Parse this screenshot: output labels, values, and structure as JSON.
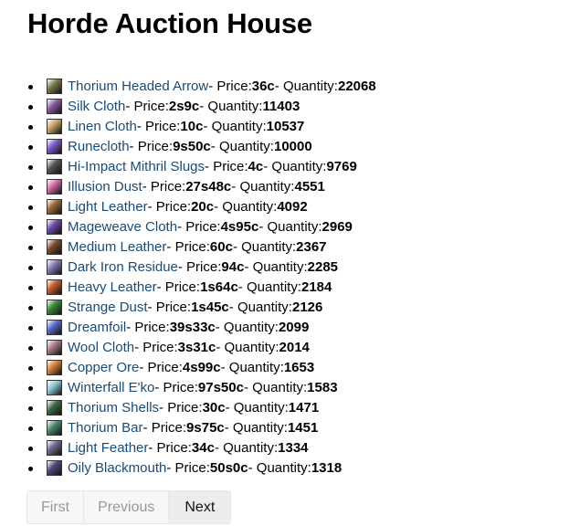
{
  "page_title": "Horde Auction House",
  "items": [
    {
      "name": "Thorium Headed Arrow",
      "price": "36c",
      "quantity": "22068",
      "icon": "arrow-icon",
      "icon_color": "#7a7a4a"
    },
    {
      "name": "Silk Cloth",
      "price": "2s9c",
      "quantity": "11403",
      "icon": "cloth-icon",
      "icon_color": "#8a5aa8"
    },
    {
      "name": "Linen Cloth",
      "price": "10c",
      "quantity": "10537",
      "icon": "cloth-icon",
      "icon_color": "#c9a46a"
    },
    {
      "name": "Runecloth",
      "price": "9s50c",
      "quantity": "10000",
      "icon": "cloth-icon",
      "icon_color": "#7a5ac8"
    },
    {
      "name": "Hi-Impact Mithril Slugs",
      "price": "4c",
      "quantity": "9769",
      "icon": "slugs-icon",
      "icon_color": "#555555"
    },
    {
      "name": "Illusion Dust",
      "price": "27s48c",
      "quantity": "4551",
      "icon": "dust-icon",
      "icon_color": "#d46aa6"
    },
    {
      "name": "Light Leather",
      "price": "20c",
      "quantity": "4092",
      "icon": "leather-icon",
      "icon_color": "#9a6a3a"
    },
    {
      "name": "Mageweave Cloth",
      "price": "4s95c",
      "quantity": "2969",
      "icon": "cloth-icon",
      "icon_color": "#6a4aa8"
    },
    {
      "name": "Medium Leather",
      "price": "60c",
      "quantity": "2367",
      "icon": "leather-icon",
      "icon_color": "#7a4a2a"
    },
    {
      "name": "Dark Iron Residue",
      "price": "94c",
      "quantity": "2285",
      "icon": "residue-icon",
      "icon_color": "#8a7ab8"
    },
    {
      "name": "Heavy Leather",
      "price": "1s64c",
      "quantity": "2184",
      "icon": "leather-icon",
      "icon_color": "#c45a2a"
    },
    {
      "name": "Strange Dust",
      "price": "1s45c",
      "quantity": "2126",
      "icon": "dust-icon",
      "icon_color": "#3a8a3a"
    },
    {
      "name": "Dreamfoil",
      "price": "39s33c",
      "quantity": "2099",
      "icon": "herb-icon",
      "icon_color": "#5a6ac8"
    },
    {
      "name": "Wool Cloth",
      "price": "3s31c",
      "quantity": "2014",
      "icon": "cloth-icon",
      "icon_color": "#a87a8a"
    },
    {
      "name": "Copper Ore",
      "price": "4s99c",
      "quantity": "1653",
      "icon": "ore-icon",
      "icon_color": "#d4823a"
    },
    {
      "name": "Winterfall E'ko",
      "price": "97s50c",
      "quantity": "1583",
      "icon": "eko-icon",
      "icon_color": "#8ac8d4"
    },
    {
      "name": "Thorium Shells",
      "price": "30c",
      "quantity": "1471",
      "icon": "shells-icon",
      "icon_color": "#3a6a4a"
    },
    {
      "name": "Thorium Bar",
      "price": "9s75c",
      "quantity": "1451",
      "icon": "bar-icon",
      "icon_color": "#4a8a6a"
    },
    {
      "name": "Light Feather",
      "price": "34c",
      "quantity": "1334",
      "icon": "feather-icon",
      "icon_color": "#6a6a8a"
    },
    {
      "name": "Oily Blackmouth",
      "price": "50s0c",
      "quantity": "1318",
      "icon": "fish-icon",
      "icon_color": "#4a4a7a"
    }
  ],
  "labels": {
    "price": "- Price:",
    "price_suffix": "-",
    "quantity": " Quantity:"
  },
  "pagination": {
    "first": "First",
    "previous": "Previous",
    "next": "Next"
  }
}
